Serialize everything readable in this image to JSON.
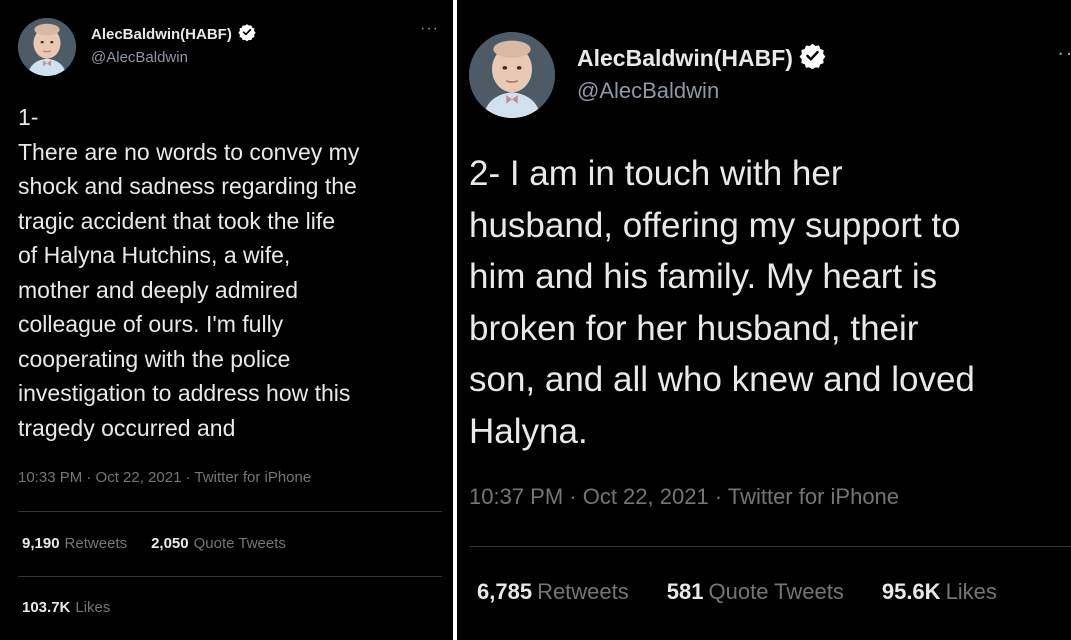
{
  "colors": {
    "background": "#000000",
    "text_primary": "#e7e9ea",
    "text_secondary": "#71767b",
    "verified_badge": "#ffffff",
    "divider": "#2f3336"
  },
  "tweets": [
    {
      "author_name": "AlecBaldwin(HABF)",
      "handle": "@AlecBaldwin",
      "more_icon": "more-horizontal-icon",
      "verified_icon": "verified-badge-icon",
      "text_lines": [
        "1-",
        "There are no words to convey my",
        "shock and sadness regarding the",
        "tragic accident that took the life",
        "of Halyna Hutchins, a wife,",
        "mother and deeply admired",
        "colleague of ours. I'm fully",
        "cooperating with the police",
        "investigation to address how this",
        "tragedy occurred and"
      ],
      "timestamp": "10:33 PM · Oct 22, 2021 · Twitter for iPhone",
      "retweets_count": "9,190",
      "retweets_label": "Retweets",
      "quotes_count": "2,050",
      "quotes_label": "Quote Tweets",
      "likes_count": "103.7K",
      "likes_label": "Likes"
    },
    {
      "author_name": "AlecBaldwin(HABF)",
      "handle": "@AlecBaldwin",
      "more_icon": "more-horizontal-icon",
      "verified_icon": "verified-badge-icon",
      "text_lines": [
        "2- I am in touch with her",
        "husband, offering my support to",
        "him and his family. My heart is",
        "broken for her husband, their",
        "son, and all who knew and loved",
        "Halyna."
      ],
      "timestamp": "10:37 PM · Oct 22, 2021 · Twitter for iPhone",
      "retweets_count": "6,785",
      "retweets_label": "Retweets",
      "quotes_count": "581",
      "quotes_label": "Quote Tweets",
      "likes_count": "95.6K",
      "likes_label": "Likes"
    }
  ]
}
